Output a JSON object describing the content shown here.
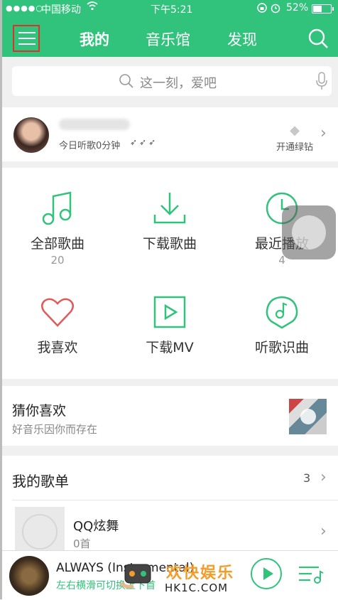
{
  "status_bar": {
    "signal": "●●●●○",
    "carrier": "中国移动",
    "time": "下午5:21",
    "battery": "52%"
  },
  "header": {
    "tabs": [
      {
        "label": "我的",
        "active": true
      },
      {
        "label": "音乐馆",
        "active": false
      },
      {
        "label": "发现",
        "active": false
      }
    ]
  },
  "search": {
    "placeholder": "这一刻，爱吧"
  },
  "profile": {
    "today_listen": "今日听歌0分钟",
    "vip_label": "开通绿钻"
  },
  "grid": [
    {
      "label": "全部歌曲",
      "count": "20",
      "icon": "music-note-icon"
    },
    {
      "label": "下载歌曲",
      "count": "",
      "icon": "download-icon"
    },
    {
      "label": "最近播放",
      "count": "4",
      "icon": "clock-icon"
    },
    {
      "label": "我喜欢",
      "count": "",
      "icon": "heart-icon"
    },
    {
      "label": "下载MV",
      "count": "",
      "icon": "mv-icon"
    },
    {
      "label": "听歌识曲",
      "count": "",
      "icon": "song-recognition-icon"
    }
  ],
  "guess": {
    "title": "猜你喜欢",
    "subtitle": "好音乐因你而存在"
  },
  "playlists": {
    "title": "我的歌单",
    "count": "3",
    "items": [
      {
        "name": "QQ炫舞",
        "count": "0首"
      }
    ]
  },
  "player": {
    "song": "ALWAYS (Instrumental)",
    "hint": "左右横滑可切换上下首"
  },
  "watermark": {
    "line1": "欢快娱乐",
    "line2": "HK1C.COM"
  },
  "colors": {
    "accent": "#31c27c",
    "highlight_border": "#d9342b"
  }
}
